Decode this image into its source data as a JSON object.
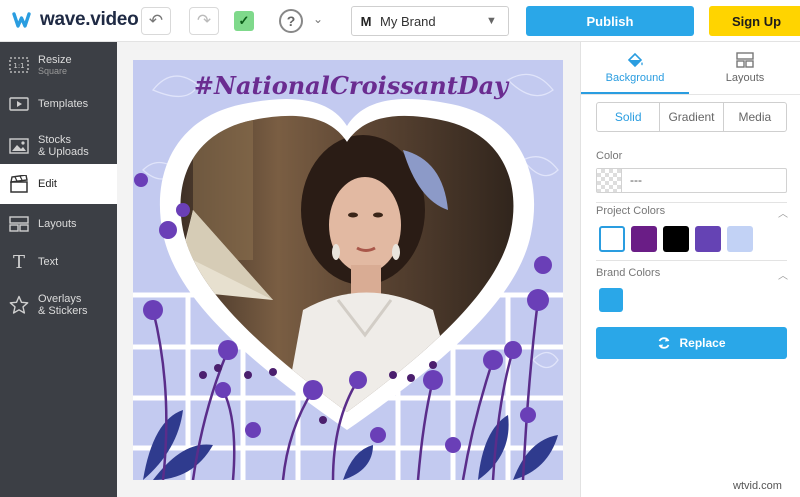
{
  "app": {
    "logo_text": "wave.video"
  },
  "toolbar": {
    "undo_icon": "undo-icon",
    "redo_icon": "redo-icon",
    "saved_icon": "check-icon",
    "help_label": "?",
    "brand_initial": "M",
    "brand_name": "My Brand",
    "publish_label": "Publish",
    "signup_label": "Sign Up"
  },
  "sidebar": {
    "items": [
      {
        "label": "Resize",
        "sub": "Square",
        "icon": "resize-icon"
      },
      {
        "label": "Templates",
        "icon": "templates-icon"
      },
      {
        "label": "Stocks",
        "label2": "& Uploads",
        "icon": "image-icon"
      },
      {
        "label": "Edit",
        "icon": "clapper-icon"
      },
      {
        "label": "Layouts",
        "icon": "layouts-icon"
      },
      {
        "label": "Text",
        "icon": "text-icon"
      },
      {
        "label": "Overlays",
        "label2": "& Stickers",
        "icon": "star-icon"
      }
    ]
  },
  "canvas": {
    "hashtag": "#NationalCroissantDay",
    "background_color": "#c4cbf0",
    "flower_color": "#6a3fb7"
  },
  "panel": {
    "tabs": [
      {
        "label": "Background"
      },
      {
        "label": "Layouts"
      }
    ],
    "segments": [
      "Solid",
      "Gradient",
      "Media"
    ],
    "color_label": "Color",
    "color_value": "---",
    "project_colors_label": "Project Colors",
    "project_colors": [
      "#ffffff",
      "#6a1d86",
      "#000000",
      "#6543b4",
      "#c2d2f5"
    ],
    "brand_colors_label": "Brand Colors",
    "brand_colors": [
      "#2aa7e8"
    ],
    "replace_label": "Replace"
  },
  "watermark": "wtvid.com"
}
